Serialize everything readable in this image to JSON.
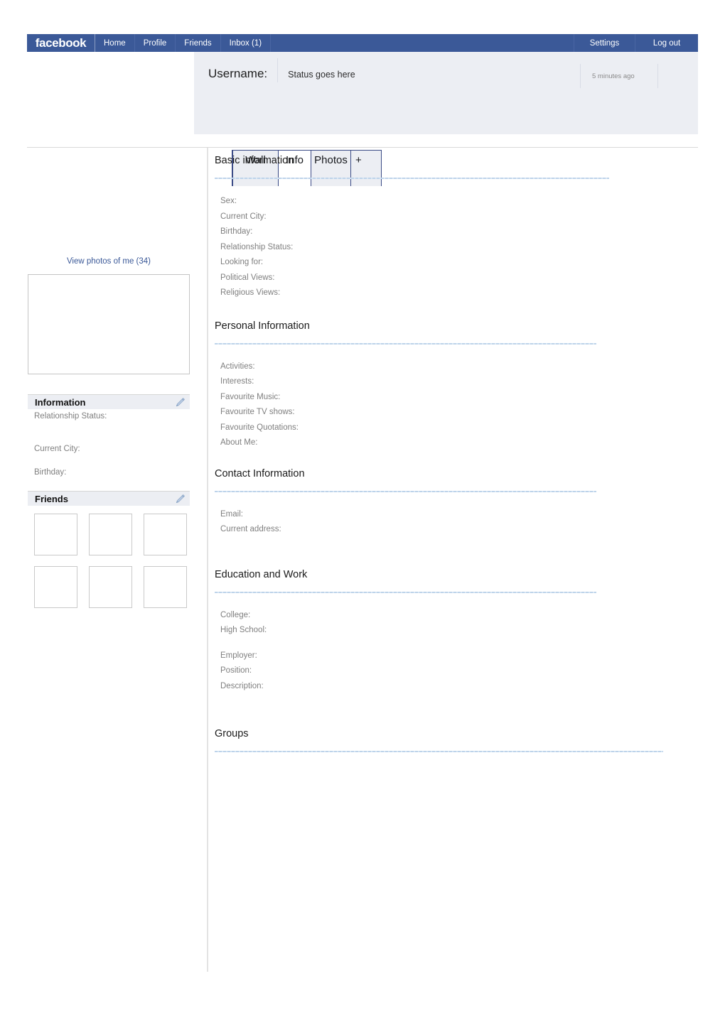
{
  "navbar": {
    "brand": "facebook",
    "links": [
      "Home",
      "Profile",
      "Friends",
      "Inbox (1)"
    ],
    "right_links": [
      "Settings",
      "Log out"
    ],
    "background_color": "#3b5998"
  },
  "header": {
    "username_label": "Username:",
    "status_text": "Status goes here",
    "status_time": "5 minutes ago"
  },
  "tabs": [
    {
      "label": "Wall",
      "active": false
    },
    {
      "label": "Info",
      "active": true
    },
    {
      "label": "Photos",
      "active": false
    },
    {
      "label": "+",
      "active": false
    }
  ],
  "sidebar": {
    "view_photos_link": "View photos of me (34)",
    "information_panel": {
      "title": "Information",
      "edit_icon": "pencil-icon",
      "fields": [
        "Relationship Status:",
        "Current City:",
        "Birthday:"
      ]
    },
    "friends_panel": {
      "title": "Friends",
      "edit_icon": "pencil-icon",
      "thumbnail_count": 6
    }
  },
  "main": {
    "sections": [
      {
        "title": "Basic information",
        "fields": [
          "Sex:",
          "Current City:",
          "Birthday:",
          "Relationship Status:",
          "Looking for:",
          "Political Views:",
          "Religious Views:"
        ]
      },
      {
        "title": "Personal Information",
        "fields": [
          "Activities:",
          "Interests:",
          "Favourite Music:",
          "Favourite TV shows:",
          "Favourite Quotations:",
          "About Me:"
        ]
      },
      {
        "title": "Contact Information",
        "fields": [
          "Email:",
          "Current address:"
        ]
      },
      {
        "title": "Education and Work",
        "fields": [
          "College:",
          "High School:",
          "",
          "Employer:",
          "Position:",
          "Description:"
        ]
      },
      {
        "title": "Groups",
        "fields": []
      }
    ]
  },
  "colors": {
    "brand_blue": "#3b5998",
    "link_blue": "#3b5998",
    "panel_gray": "#eceef3",
    "rule_blue": "#bdd3ea",
    "field_gray": "#7f7f7f"
  }
}
